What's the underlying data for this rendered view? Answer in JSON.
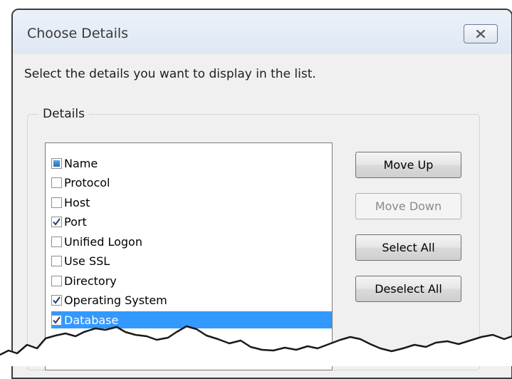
{
  "dialog": {
    "title": "Choose Details",
    "close_icon": "close-icon",
    "intro": "Select the details you want to display in the list.",
    "group_label": "Details"
  },
  "details_list": {
    "items": [
      {
        "label": "Name",
        "state": "indeterminate",
        "selected": false
      },
      {
        "label": "Protocol",
        "state": "unchecked",
        "selected": false
      },
      {
        "label": "Host",
        "state": "unchecked",
        "selected": false
      },
      {
        "label": "Port",
        "state": "checked",
        "selected": false
      },
      {
        "label": "Unified Logon",
        "state": "unchecked",
        "selected": false
      },
      {
        "label": "Use SSL",
        "state": "unchecked",
        "selected": false
      },
      {
        "label": "Directory",
        "state": "unchecked",
        "selected": false
      },
      {
        "label": "Operating System",
        "state": "checked",
        "selected": false
      },
      {
        "label": "Database",
        "state": "checked",
        "selected": true
      }
    ]
  },
  "buttons": {
    "move_up": "Move Up",
    "move_down": "Move Down",
    "move_down_enabled": false,
    "select_all": "Select All",
    "deselect_all": "Deselect All"
  },
  "colors": {
    "selection": "#3399ff",
    "dialog_bg": "#f0f0f0"
  }
}
